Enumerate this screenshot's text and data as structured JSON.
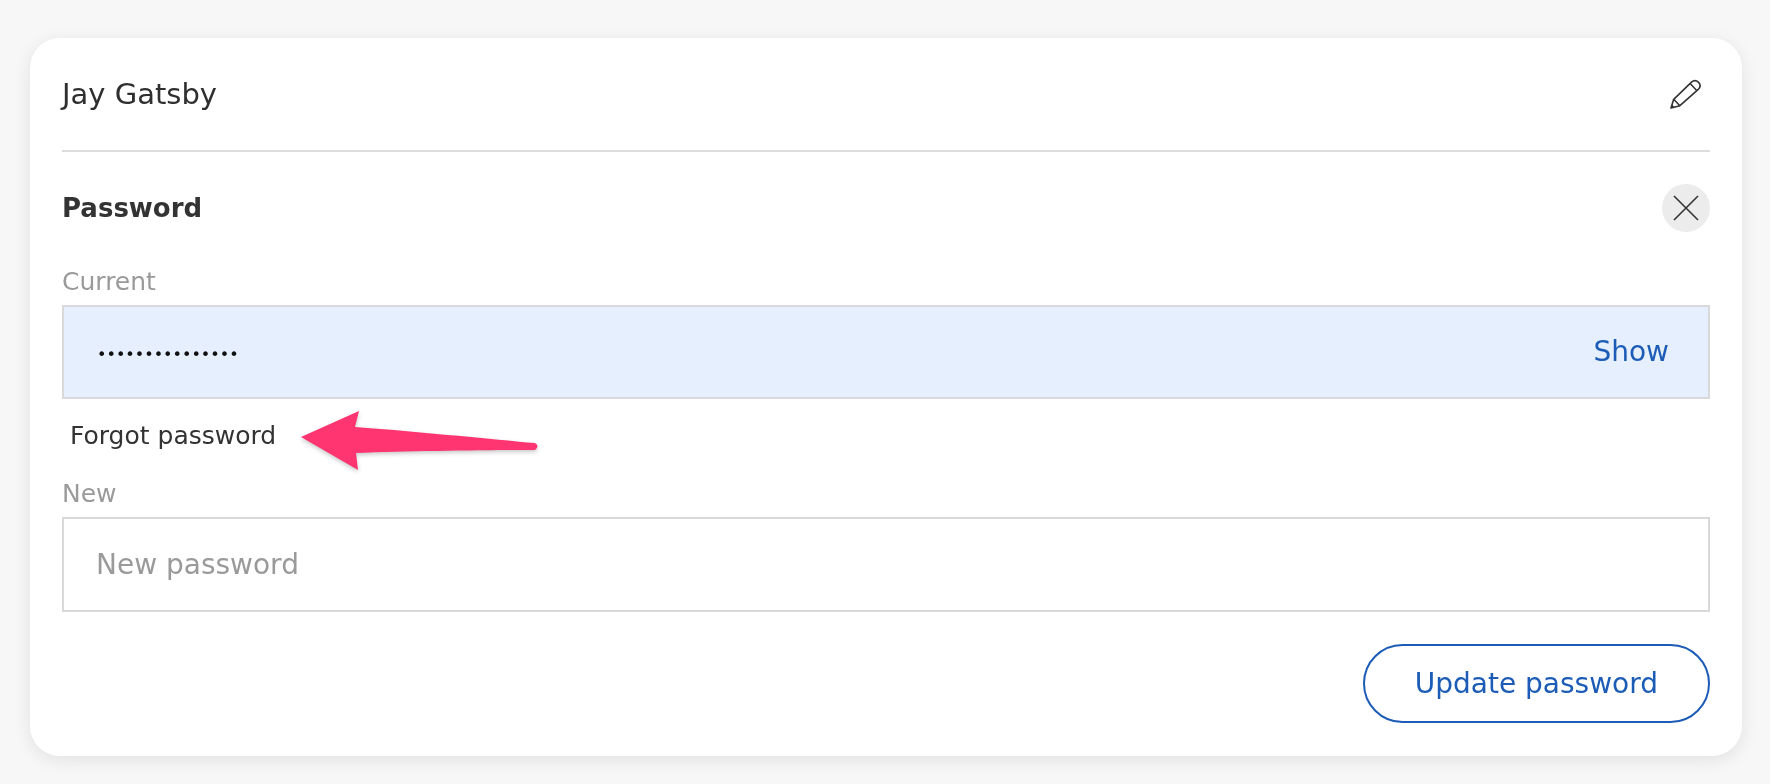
{
  "profile": {
    "name": "Jay Gatsby"
  },
  "password_section": {
    "title": "Password",
    "current": {
      "label": "Current",
      "value": "•••••••••••••••",
      "autofilled": true,
      "toggle": "Show"
    },
    "forgot_link": "Forgot password",
    "new": {
      "label": "New",
      "placeholder": "New password"
    },
    "submit_button": "Update password"
  }
}
